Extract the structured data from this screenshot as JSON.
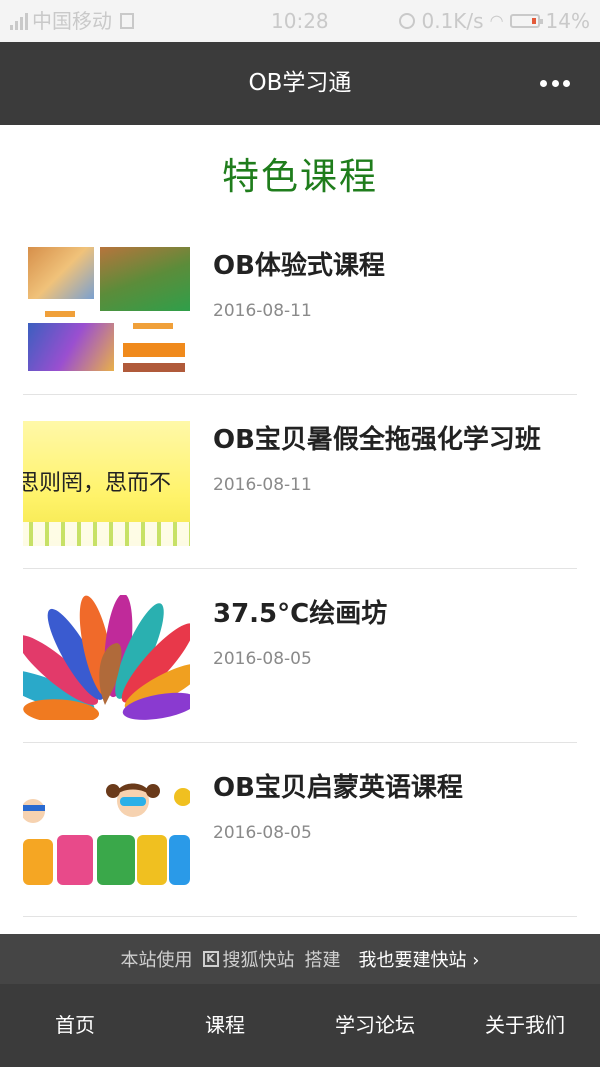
{
  "status_bar": {
    "carrier": "中国移动",
    "time": "10:28",
    "speed": "0.1K/s",
    "battery": "14%"
  },
  "header": {
    "title": "OB学习通",
    "more_icon": "more-dots-icon"
  },
  "section": {
    "title": "特色课程"
  },
  "courses": [
    {
      "title": "OB体验式课程",
      "date": "2016-08-11",
      "thumb": "photo-collage"
    },
    {
      "title": "OB宝贝暑假全拖强化学习班",
      "date": "2016-08-11",
      "thumb_text": "思则罔，思而不",
      "thumb": "calligraphy-banner"
    },
    {
      "title": "37.5°C绘画坊",
      "date": "2016-08-05",
      "thumb": "paper-peacock"
    },
    {
      "title": "OB宝贝启蒙英语课程",
      "date": "2016-08-05",
      "thumb": "summer-kids"
    }
  ],
  "footer": {
    "prefix": "本站使用",
    "brand": "搜狐快站",
    "suffix": "搭建",
    "cta": "我也要建快站",
    "chevron": "›"
  },
  "nav": {
    "items": [
      "首页",
      "课程",
      "学习论坛",
      "关于我们"
    ]
  },
  "colors": {
    "header_bg": "#3b3b3b",
    "section_title": "#1f7d1c",
    "footer_band": "#454545"
  }
}
